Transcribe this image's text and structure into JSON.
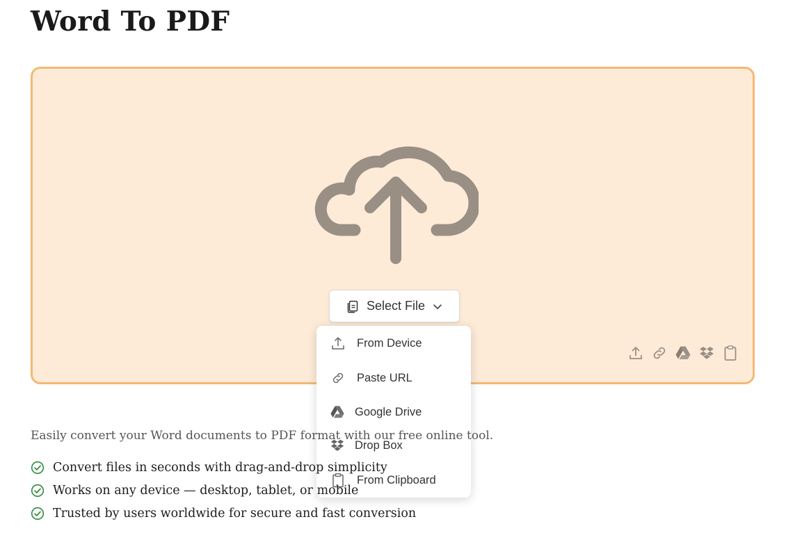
{
  "page": {
    "title": "Word To PDF"
  },
  "uploader": {
    "select_label": "Select File",
    "menu": [
      {
        "label": "From Device",
        "icon": "upload-icon"
      },
      {
        "label": "Paste URL",
        "icon": "link-icon"
      },
      {
        "label": "Google Drive",
        "icon": "google-drive-icon"
      },
      {
        "label": "Drop Box",
        "icon": "dropbox-icon"
      },
      {
        "label": "From Clipboard",
        "icon": "clipboard-icon"
      }
    ],
    "quick_icons": [
      "upload-icon",
      "link-icon",
      "google-drive-icon",
      "dropbox-icon",
      "clipboard-icon"
    ]
  },
  "description": "Easily convert your Word documents to PDF format with our free online tool.",
  "features": [
    "Convert files in seconds with drag-and-drop simplicity",
    "Works on any device — desktop, tablet, or mobile",
    "Trusted by users worldwide for secure and fast conversion"
  ],
  "colors": {
    "dropzone_bg": "#fdebd8",
    "dropzone_border": "#f4b874",
    "icon_gray": "#9a8f84",
    "check_green": "#2e8b3a"
  }
}
